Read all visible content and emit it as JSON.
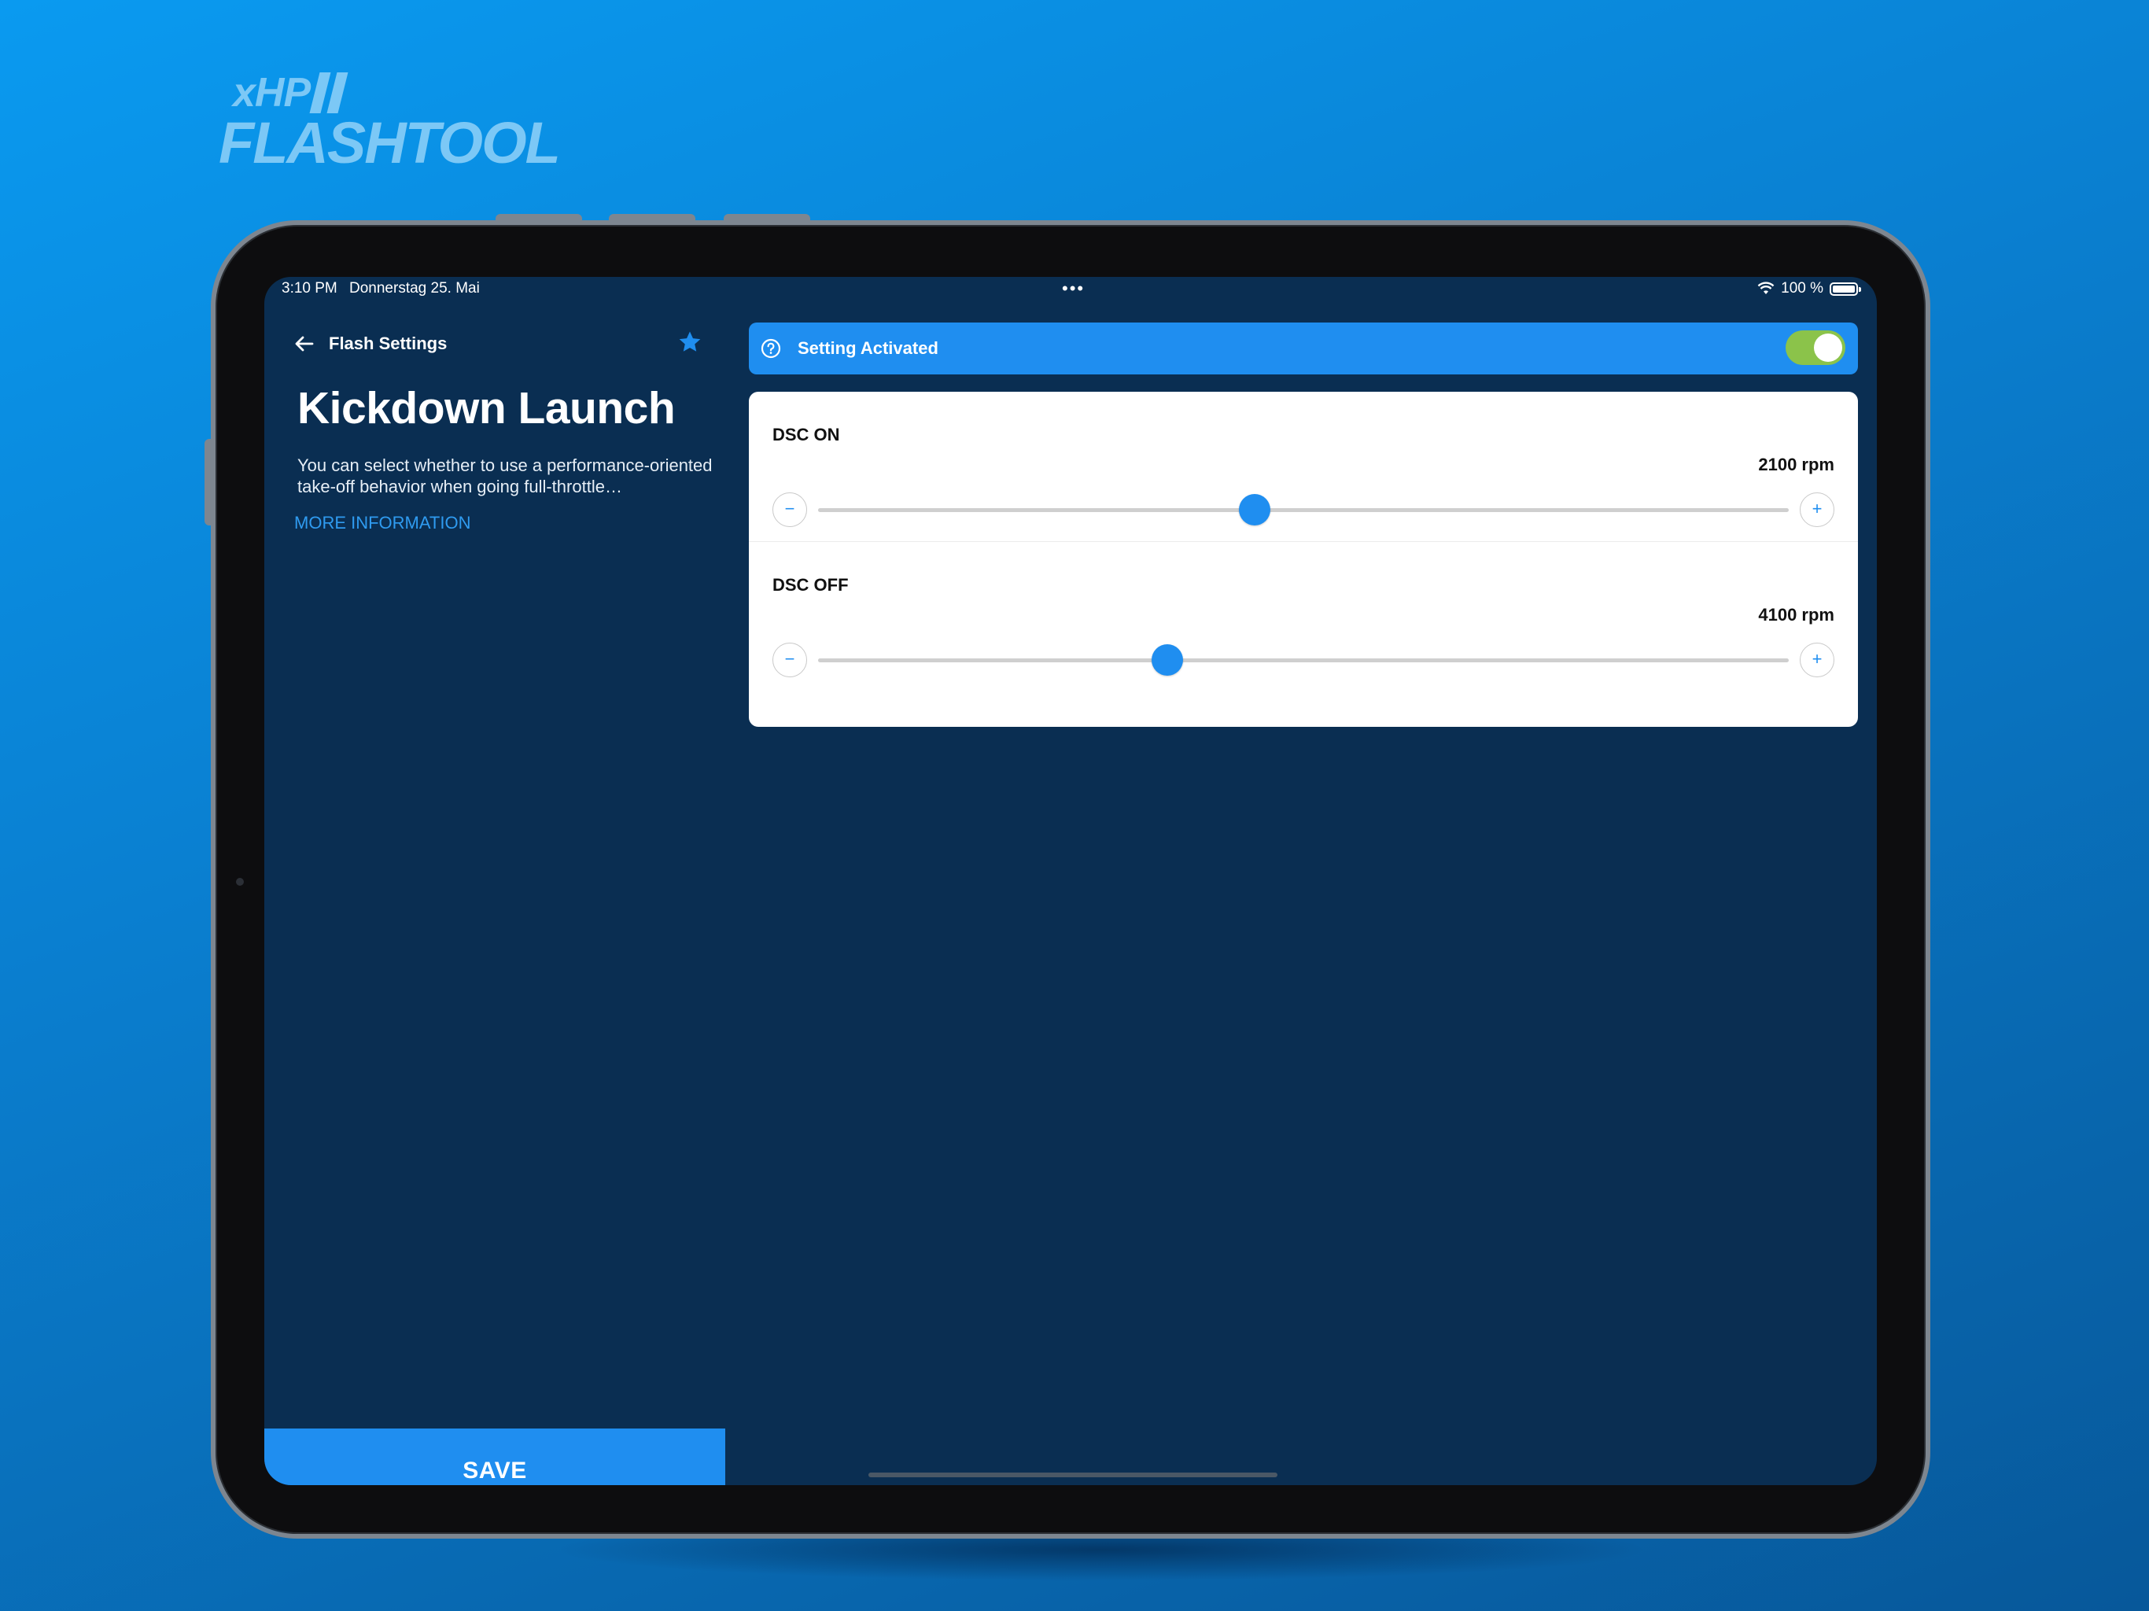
{
  "logo": {
    "line1": "xHP",
    "line2": "FLASHTOOL"
  },
  "statusbar": {
    "time": "3:10 PM",
    "date": "Donnerstag 25. Mai",
    "battery": "100 %"
  },
  "nav": {
    "back_label": "Flash Settings",
    "favorite": true
  },
  "page": {
    "title": "Kickdown Launch",
    "description": "You can select whether to use a performance-oriented take-off behavior when going full-throttle…",
    "more_info": "MORE INFORMATION",
    "save": "SAVE"
  },
  "activation": {
    "label": "Setting Activated",
    "enabled": true
  },
  "sliders": [
    {
      "label": "DSC ON",
      "value_text": "2100 rpm",
      "level": 0.45
    },
    {
      "label": "DSC OFF",
      "value_text": "4100 rpm",
      "level": 0.36
    }
  ],
  "colors": {
    "accent": "#1f8ef0",
    "screen_bg": "#0a2e52",
    "toggle_on": "#8bc34a"
  },
  "icons": [
    "back-arrow-icon",
    "star-icon",
    "help-circle-icon",
    "wifi-icon",
    "battery-icon",
    "minus-icon",
    "plus-icon"
  ]
}
